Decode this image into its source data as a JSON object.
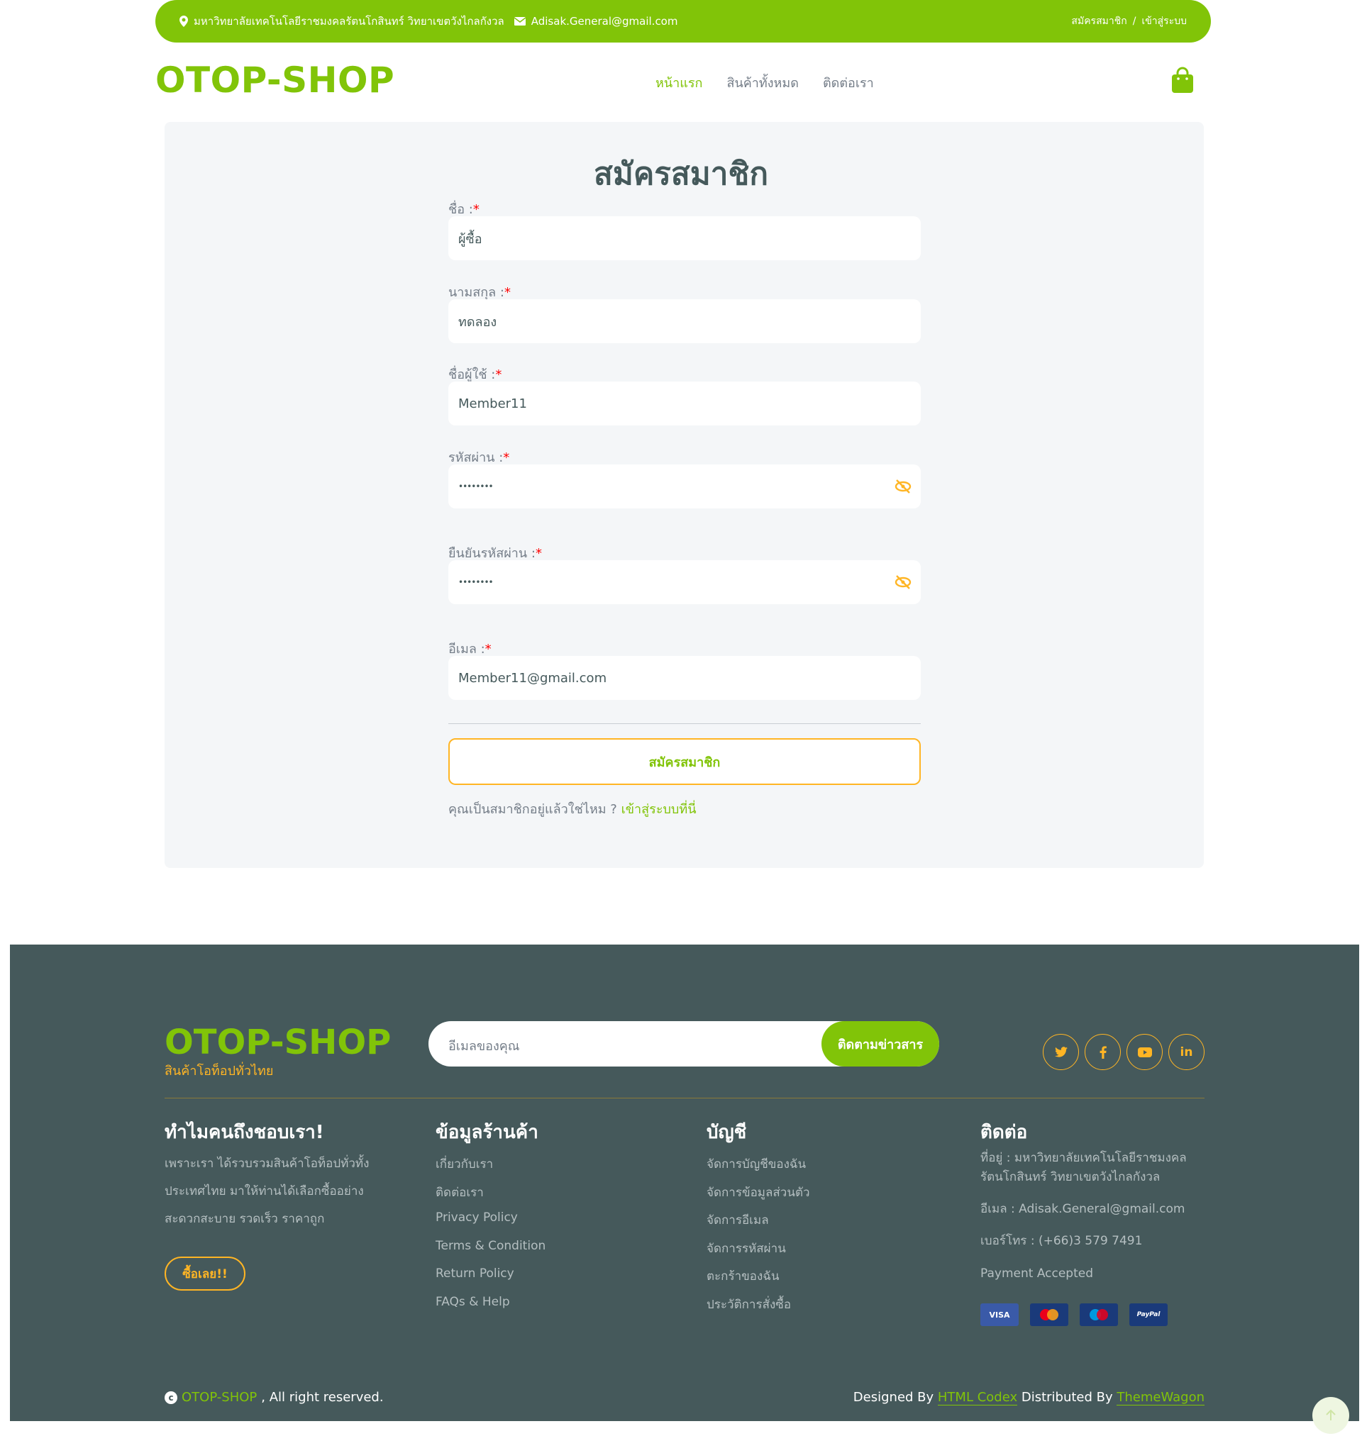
{
  "topbar": {
    "address": "มหาวิทยาลัยเทคโนโลยีราชมงคลรัตนโกสินทร์ วิทยาเขตวังไกลกังวล",
    "email": "Adisak.General@gmail.com",
    "register": "สมัครสมาชิก",
    "separator": "/",
    "login": "เข้าสู่ระบบ"
  },
  "brand": "OTOP-SHOP",
  "nav": {
    "home": "หน้าแรก",
    "products": "สินค้าทั้งหมด",
    "contact": "ติดต่อเรา"
  },
  "form": {
    "title": "สมัครสมาชิก",
    "required_mark": "*",
    "first_name_label": "ชื่อ :",
    "first_name_value": "ผู้ซื้อ",
    "last_name_label": "นามสกุล :",
    "last_name_value": "ทดลอง",
    "username_label": "ชื่อผู้ใช้ :",
    "username_value": "Member11",
    "password_label": "รหัสผ่าน :",
    "password_value": "••••••••",
    "confirm_label": "ยืนยันรหัสผ่าน :",
    "confirm_value": "••••••••",
    "email_label": "อีเมล :",
    "email_value": "Member11@gmail.com",
    "submit": "สมัครสมาชิก",
    "already_text": "คุณเป็นสมาชิกอยู่แล้วใช่ไหม ? ",
    "login_link": "เข้าสู่ระบบที่นี่"
  },
  "footer": {
    "brand": "OTOP-SHOP",
    "tagline": "สินค้าโอท็อปทั่วไทย",
    "newsletter_placeholder": "อีเมลของคุณ",
    "newsletter_button": "ติดตามข่าวสาร",
    "socials": [
      "twitter-icon",
      "facebook-icon",
      "youtube-icon",
      "linkedin-icon"
    ],
    "col1_title": "ทำไมคนถึงชอบเรา!",
    "col1_text_1": "เพราะเรา ได้รวบรวมสินค้าโอท็อปทั่วทั้ง",
    "col1_text_2": "ประเทศไทย มาให้ท่านได้เลือกซื้ออย่าง",
    "col1_text_3": "สะดวกสะบาย รวดเร็ว ราคาถูก",
    "buy_button": "ซื้อเลย!!",
    "col2_title": "ข้อมูลร้านค้า",
    "col2_links": [
      "เกี่ยวกับเรา",
      "ติดต่อเรา",
      "Privacy Policy",
      "Terms & Condition",
      "Return Policy",
      "FAQs & Help"
    ],
    "col3_title": "บัญชี",
    "col3_links": [
      "จัดการบัญชีของฉัน",
      "จัดการข้อมูลส่วนตัว",
      "จัดการอีเมล",
      "จัดการรหัสผ่าน",
      "ตะกร้าของฉัน",
      "ประวัติการสั่งซื้อ"
    ],
    "col4_title": "ติดต่อ",
    "address_1": "ที่อยู่ : มหาวิทยาลัยเทคโนโลยีราชมงคล",
    "address_2": "รัตนโกสินทร์ วิทยาเขตวังไกลกังวล",
    "email": "อีเมล : Adisak.General@gmail.com",
    "phone": "เบอร์โทร : (+66)3 579 7491",
    "payment_label": "Payment Accepted",
    "payment_cards": [
      "VISA",
      "MasterCard",
      "Maestro",
      "PayPal"
    ],
    "copyright_brand": "OTOP-SHOP",
    "copyright_rest": ", All right reserved.",
    "designed_by": "Designed By ",
    "designer": "HTML Codex",
    "distributed_by": " Distributed By ",
    "distributor": "ThemeWagon"
  },
  "colors": {
    "primary": "#81c408",
    "secondary": "#ffb524",
    "dark": "#45595b"
  }
}
